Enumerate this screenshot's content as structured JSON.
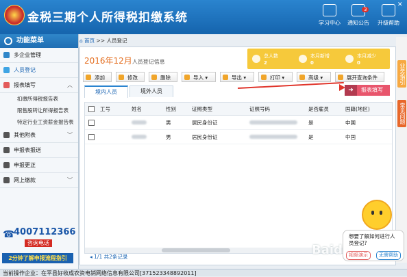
{
  "app": {
    "title": "金税三期个人所得税扣缴系统"
  },
  "topbar": {
    "buttons": [
      {
        "label": "学习中心",
        "icon": "play-icon"
      },
      {
        "label": "通知公告",
        "icon": "mail-icon",
        "badge": "3"
      },
      {
        "label": "升级帮助",
        "icon": "upgrade-icon"
      }
    ]
  },
  "sidebar": {
    "header": "功能菜单",
    "items": [
      {
        "label": "多企业管理"
      },
      {
        "label": "人员登记"
      },
      {
        "label": "报表填写"
      }
    ],
    "sub_items": [
      "扣缴所得税报告表",
      "限售股转让所得报告表",
      "特定行业工资薪金报告表"
    ],
    "more_items": [
      {
        "label": "其他附表"
      },
      {
        "label": "申报表报送"
      },
      {
        "label": "申报更正"
      },
      {
        "label": "网上缴款"
      }
    ],
    "phone": "4007112366",
    "phone_label": "咨询电话",
    "promo": "2分钟了解申报流程指引"
  },
  "breadcrumb": {
    "home": "首页",
    "sep": ">>",
    "current": "人员登记"
  },
  "main": {
    "period": "2016年12月",
    "period_suffix": "人员登记信息",
    "stats": [
      {
        "label": "总人数",
        "value": "2"
      },
      {
        "label": "本月新增",
        "value": "0"
      },
      {
        "label": "本月减少",
        "value": "0"
      }
    ],
    "toolbar": [
      "添加",
      "修改",
      "删除",
      "导入 ▾",
      "导出 ▾",
      "打印 ▾",
      "高级 ▾",
      "展开查询条件"
    ],
    "tabs": [
      "境内人员",
      "境外人员"
    ],
    "report_button": "报表填写",
    "columns": [
      "工号",
      "姓名",
      "性别",
      "证照类型",
      "证照号码",
      "是否雇员",
      "国籍(地区)"
    ],
    "rows": [
      {
        "gender": "男",
        "id_type": "居民身份证",
        "employee": "是",
        "nation": "中国"
      },
      {
        "gender": "男",
        "id_type": "居民身份证",
        "employee": "是",
        "nation": "中国"
      }
    ],
    "pager": "1/1 共2条记录"
  },
  "right_rail": {
    "tabs": [
      "业务指引",
      "常见问题"
    ]
  },
  "helper": {
    "question": "想要了解如何进行人员登记?",
    "btn_learn": "视频演示",
    "btn_close": "无需帮助"
  },
  "watermark": "Baidu 经验",
  "statusbar": "当前操作企业：在平县好收成农资电销网络信息有限公司[371523348892011]"
}
